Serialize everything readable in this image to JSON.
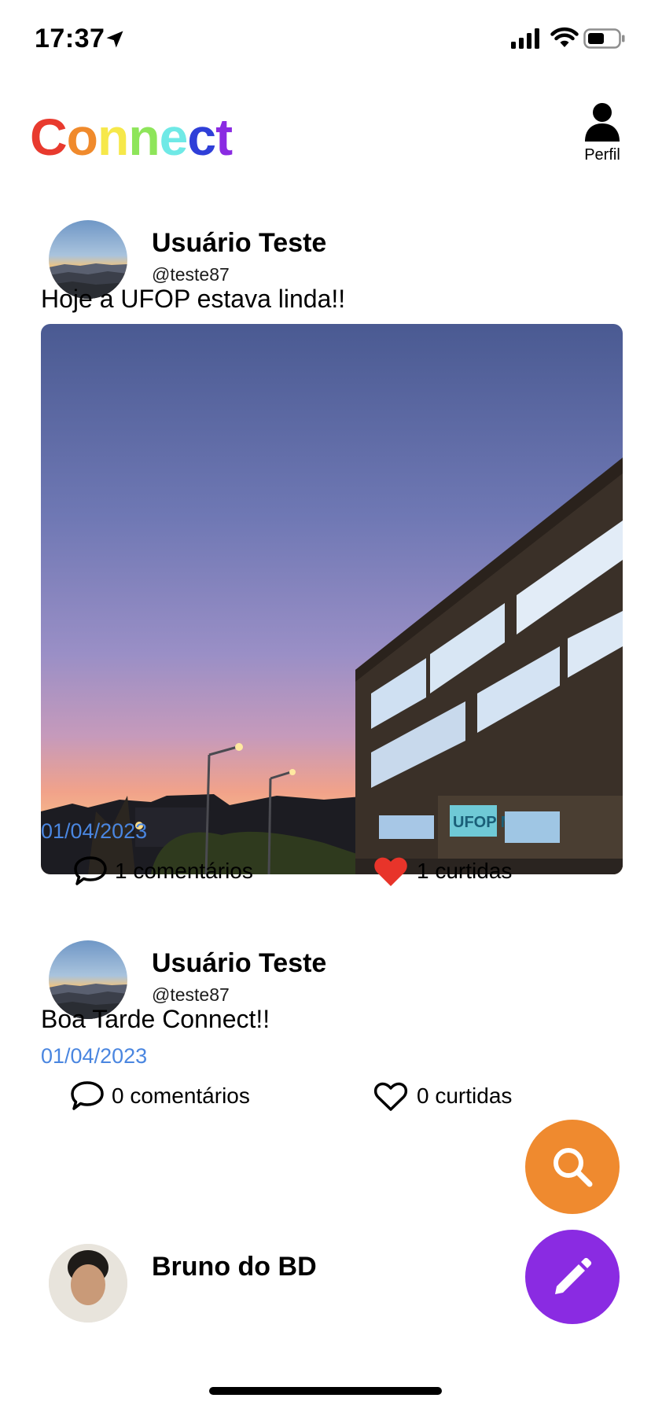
{
  "status_bar": {
    "time": "17:37"
  },
  "header": {
    "logo_letters": [
      {
        "char": "C",
        "color": "#e83a2e"
      },
      {
        "char": "o",
        "color": "#f08a2c"
      },
      {
        "char": "n",
        "color": "#f6e84a"
      },
      {
        "char": "n",
        "color": "#8ee55a"
      },
      {
        "char": "e",
        "color": "#6fe9e6"
      },
      {
        "char": "c",
        "color": "#2f3fd8"
      },
      {
        "char": "t",
        "color": "#8a2be2"
      }
    ],
    "profile_label": "Perfil"
  },
  "posts": [
    {
      "user_name": "Usuário Teste",
      "handle": "@teste87",
      "text": "Hoje a UFOP estava linda!!",
      "image_sign_text": "UFOP M",
      "date": "01/04/2023",
      "comments": "1 comentários",
      "likes": "1 curtidas",
      "liked": true
    },
    {
      "user_name": "Usuário Teste",
      "handle": "@teste87",
      "text": "Boa Tarde Connect!!",
      "date": "01/04/2023",
      "comments": "0 comentários",
      "likes": "0 curtidas",
      "liked": false
    },
    {
      "user_name": "Bruno do BD"
    }
  ],
  "colors": {
    "date": "#4a86e0",
    "like_red": "#e8342a",
    "fab_search": "#ef8a2f",
    "fab_edit": "#8a2be2"
  }
}
